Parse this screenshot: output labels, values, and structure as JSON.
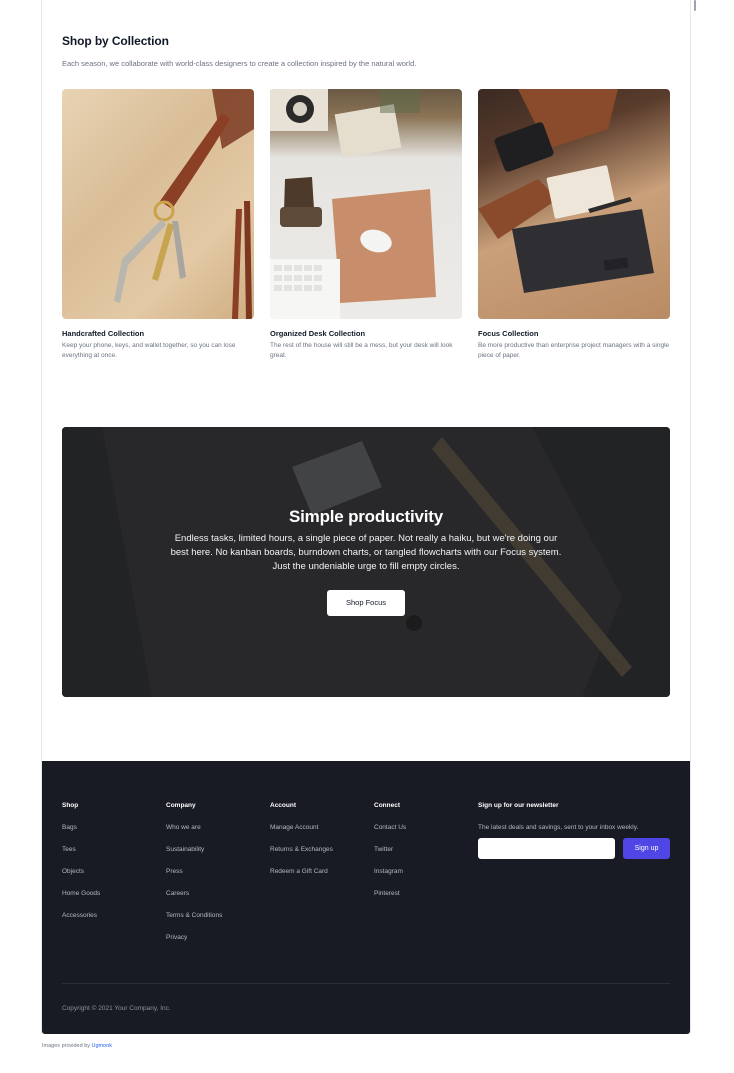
{
  "collections": {
    "title": "Shop by Collection",
    "intro": "Each season, we collaborate with world-class designers to create a collection inspired by the natural world.",
    "items": [
      {
        "name": "Handcrafted Collection",
        "description": "Keep your phone, keys, and wallet together, so you can lose everything at once."
      },
      {
        "name": "Organized Desk Collection",
        "description": "The rest of the house will still be a mess, but your desk will look great."
      },
      {
        "name": "Focus Collection",
        "description": "Be more productive than enterprise project managers with a single piece of paper."
      }
    ]
  },
  "promo": {
    "title": "Simple productivity",
    "description": "Endless tasks, limited hours, a single piece of paper. Not really a haiku, but we're doing our best here. No kanban boards, burndown charts, or tangled flowcharts with our Focus system. Just the undeniable urge to fill empty circles.",
    "button": "Shop Focus"
  },
  "footer": {
    "columns": [
      {
        "title": "Shop",
        "links": [
          "Bags",
          "Tees",
          "Objects",
          "Home Goods",
          "Accessories"
        ]
      },
      {
        "title": "Company",
        "links": [
          "Who we are",
          "Sustainability",
          "Press",
          "Careers",
          "Terms & Conditions",
          "Privacy"
        ]
      },
      {
        "title": "Account",
        "links": [
          "Manage Account",
          "Returns & Exchanges",
          "Redeem a Gift Card"
        ]
      },
      {
        "title": "Connect",
        "links": [
          "Contact Us",
          "Twitter",
          "Instagram",
          "Pinterest"
        ]
      }
    ],
    "newsletter": {
      "title": "Sign up for our newsletter",
      "text": "The latest deals and savings, sent to your inbox weekly.",
      "button": "Sign up",
      "placeholder": ""
    },
    "copyright": "Copyright © 2021 Your Company, Inc."
  },
  "credit": {
    "prefix": "Images provided by",
    "link": "Ugmonk"
  },
  "colors": {
    "accent": "#4f46e5",
    "footer_bg": "#181b24",
    "link": "#2563eb"
  }
}
